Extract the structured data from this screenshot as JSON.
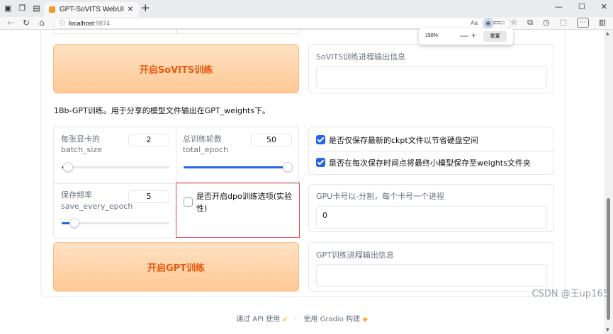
{
  "browser": {
    "tab_title": "GPT-SoVITS WebUI",
    "tab_close": "✕",
    "new_tab": "+",
    "url_host": "localhost",
    "url_port": ":9874",
    "aa_label": "Aa",
    "min_glyph": "—",
    "max_glyph": "☐",
    "close_glyph": "✕",
    "more_glyph": "···"
  },
  "zoom_popup": {
    "percent": "150%",
    "minus": "—",
    "plus": "+",
    "reset": "重置"
  },
  "sovits": {
    "train_button": "开启SoVITS训练",
    "output_label": "SoVITS训练进程输出信息",
    "output_value": ""
  },
  "gpt_section": {
    "description": "1Bb-GPT训练。用于分享的模型文件输出在GPT_weights下。",
    "batch_size": {
      "label1": "每张显卡的",
      "label2": "batch_size",
      "value": "2",
      "level": 0.05
    },
    "total_epoch": {
      "label1": "总训练轮数",
      "label2": "total_epoch",
      "value": "50",
      "level": 1.0
    },
    "save_every_epoch": {
      "label1": "保存频率",
      "label2": "save_every_epoch",
      "value": "5",
      "level": 0.1
    },
    "checkbox_latest": {
      "label": "是否仅保存最新的ckpt文件以节省硬盘空间",
      "checked": true
    },
    "checkbox_save_small": {
      "label": "是否在每次保存时间点将最终小模型保存至weights文件夹",
      "checked": true
    },
    "dpo": {
      "label_line1": "是否开启dpo训练选项(实验",
      "label_line2": "性)",
      "checked": false
    },
    "gpu_label": "GPU卡号以-分割，每个卡号一个进程",
    "gpu_value": "0",
    "train_button": "开启GPT训练",
    "output_label": "GPT训练进程输出信息",
    "output_value": ""
  },
  "footer": {
    "api_text": "通过 API 使用",
    "sep": "·",
    "gradio_text": "使用 Gradio 构建"
  },
  "watermark": "CSDN @王up165",
  "colors": {
    "accent": "#2563eb",
    "orange_text": "#ea580c",
    "highlight_border": "#e0464c"
  }
}
